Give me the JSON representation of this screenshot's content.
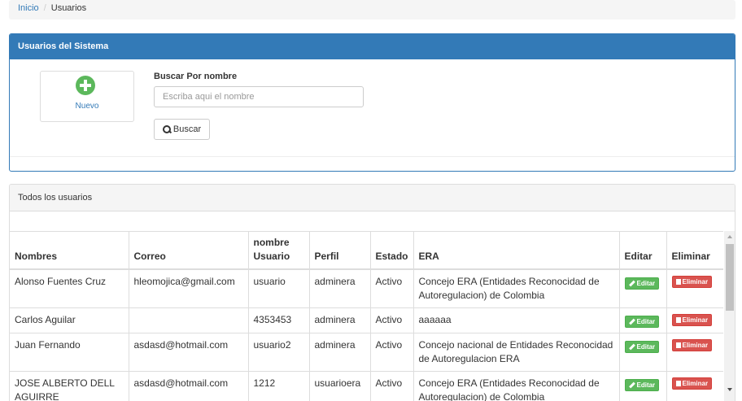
{
  "breadcrumb": {
    "home": "Inicio",
    "separator": "/",
    "current": "Usuarios"
  },
  "system_panel": {
    "title": "Usuarios del Sistema",
    "nuevo_label": "Nuevo",
    "search_label": "Buscar Por nombre",
    "search_placeholder": "Escriba aqui el nombre",
    "search_value": "",
    "search_button": "Buscar"
  },
  "users_panel": {
    "title": "Todos los usuarios",
    "columns": [
      "Nombres",
      "Correo",
      "nombre Usuario",
      "Perfil",
      "Estado",
      "ERA",
      "Editar",
      "Eliminar"
    ],
    "rows": [
      {
        "nombres": "Alonso Fuentes Cruz",
        "correo": "hleomojica@gmail.com",
        "usuario": "usuario",
        "perfil": "adminera",
        "estado": "Activo",
        "era": "Concejo ERA (Entidades Reconocidad de Autoregulacion) de Colombia"
      },
      {
        "nombres": "Carlos Aguilar",
        "correo": "",
        "usuario": "4353453",
        "perfil": "adminera",
        "estado": "Activo",
        "era": "aaaaaa"
      },
      {
        "nombres": "Juan Fernando",
        "correo": "asdasd@hotmail.com",
        "usuario": "usuario2",
        "perfil": "adminera",
        "estado": "Activo",
        "era": "Concejo nacional de Entidades Reconocidad de Autoregulacion ERA"
      },
      {
        "nombres": "JOSE ALBERTO DELL AGUIRRE",
        "correo": "asdasd@hotmail.com",
        "usuario": "1212",
        "perfil": "usuarioera",
        "estado": "Activo",
        "era": "Concejo ERA (Entidades Reconocidad de Autoregulacion) de Colombia"
      }
    ],
    "edit_label": "Editar",
    "delete_label": "Eliminar"
  },
  "colors": {
    "primary": "#337ab7",
    "success": "#5cb85c",
    "danger": "#d9534f"
  },
  "icons": {
    "nuevo": "plus-circle-icon",
    "buscar": "search-icon",
    "editar": "pencil-icon",
    "eliminar": "trash-icon"
  }
}
